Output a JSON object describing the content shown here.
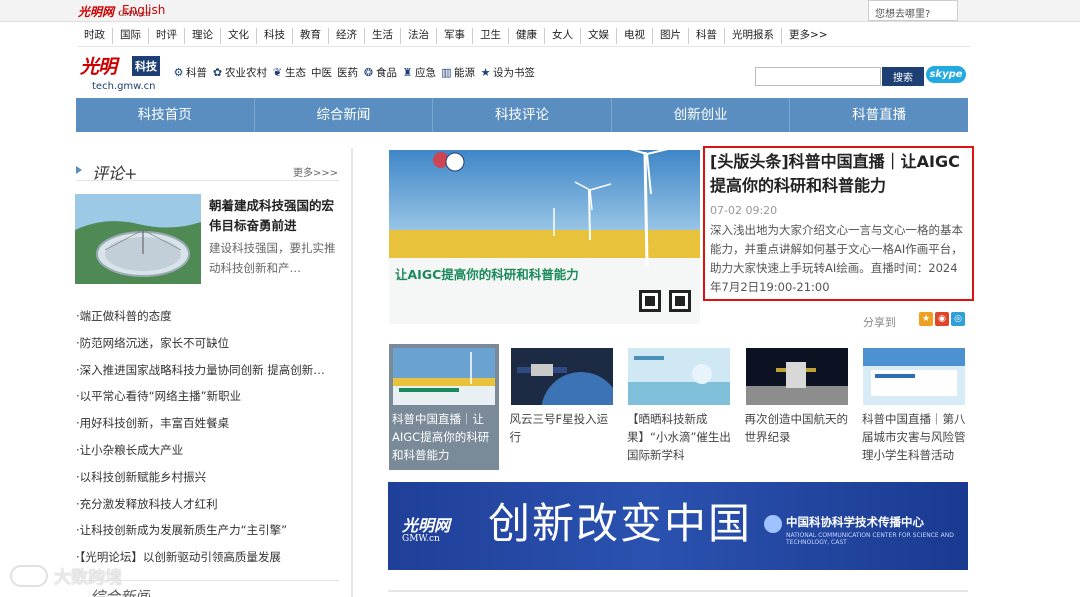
{
  "topbar": {
    "logo_text": "光明网",
    "logo_sub": "GMW.cn",
    "english_link": "English",
    "search_prompt": "您想去哪里?"
  },
  "categories": [
    "时政",
    "国际",
    "时评",
    "理论",
    "文化",
    "科技",
    "教育",
    "经济",
    "生活",
    "法治",
    "军事",
    "卫生",
    "健康",
    "女人",
    "文娱",
    "电视",
    "图片",
    "科普",
    "光明报系",
    "更多>>"
  ],
  "brand": {
    "logo_text": "光明",
    "channel": "科技",
    "url": "tech.gmw.cn"
  },
  "subnav": [
    {
      "label": "科普",
      "icon": "gear-icon"
    },
    {
      "label": "农业农村",
      "icon": "farm-icon"
    },
    {
      "label": "生态",
      "icon": "leaf-icon"
    },
    {
      "label": "中医",
      "icon": ""
    },
    {
      "label": "医药",
      "icon": ""
    },
    {
      "label": "食品",
      "icon": "food-icon"
    },
    {
      "label": "应急",
      "icon": "alarm-icon"
    },
    {
      "label": "能源",
      "icon": "energy-icon"
    },
    {
      "label": "设为书签",
      "icon": "star-icon"
    }
  ],
  "search": {
    "placeholder": "",
    "button": "搜索",
    "skype": "skype"
  },
  "mainnav": [
    "科技首页",
    "综合新闻",
    "科技评论",
    "创新创业",
    "科普直播"
  ],
  "sidebar": {
    "section_title": "评论+",
    "more_label": "更多>>>",
    "feature": {
      "title": "朝着建成科技强国的宏伟目标奋勇前进",
      "desc": "建设科技强国，要扎实推动科技创新和产…"
    },
    "list": [
      "·端正做科普的态度",
      "·防范网络沉迷，家长不可缺位",
      "·深入推进国家战略科技力量协同创新 提高创新…",
      "·以平常心看待“网络主播”新职业",
      "·用好科技创新，丰富百姓餐桌",
      "·让小杂粮长成大产业",
      "·以科技创新赋能乡村振兴",
      "·充分激发释放科技人才红利",
      "·让科技创新成为发展新质生产力“主引擎”",
      "·【光明论坛】以创新驱动引领高质量发展"
    ],
    "next_section_title": "综合新闻"
  },
  "hero": {
    "image_title": "让AIGC提高你的科研和科普能力",
    "headline": "[头版头条]科普中国直播｜让AIGC提高你的科研和科普能力",
    "time": "07-02 09:20",
    "desc": "深入浅出地为大家介绍文心一言与文心一格的基本能力，并重点讲解如何基于文心一格AI作画平台，助力大家快速上手玩转AI绘画。直播时间：2024年7月2日19:00-21:00",
    "share_label": "分享到"
  },
  "thumbs": [
    {
      "caption": "科普中国直播｜让AIGC提高你的科研和科普能力",
      "active": true
    },
    {
      "caption": "风云三号F星投入运行",
      "active": false
    },
    {
      "caption": "【晒晒科技新成果】“小水滴”催生出国际新学科",
      "active": false
    },
    {
      "caption": "再次创造中国航天的世界纪录",
      "active": false
    },
    {
      "caption": "科普中国直播｜第八届城市灾害与风险管理小学生科普活动",
      "active": false
    }
  ],
  "banner": {
    "logo": "光明网",
    "logo_sub": "GMW.cn",
    "slogan": "创新改变中国",
    "org": "中国科协科学技术传播中心",
    "org_en": "NATIONAL COMMUNICATION CENTER FOR SCIENCE AND TECHNOLOGY, CAST"
  },
  "watermark": "大数跨境",
  "colors": {
    "brand_red": "#cc0000",
    "nav_blue": "#5b8ec0",
    "dark_blue": "#1e3f73",
    "highlight_border": "#dd1111"
  }
}
